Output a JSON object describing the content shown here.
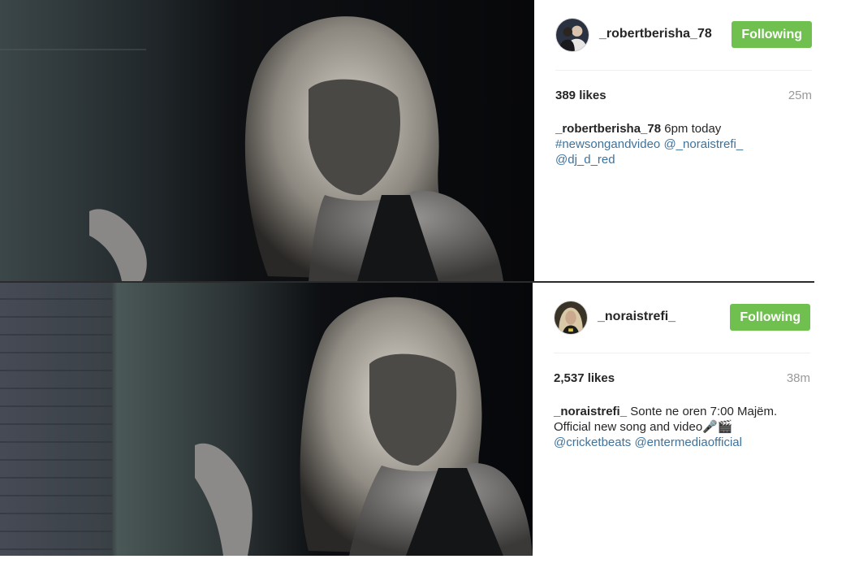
{
  "posts": [
    {
      "username": "_robertberisha_78",
      "follow_label": "Following",
      "likes": "389 likes",
      "time": "25m",
      "caption_user": "_robertberisha_78",
      "caption_text": "6pm today",
      "tags": [
        "#newsongandvideo",
        "@_noraistrefi_",
        "@dj_d_red"
      ]
    },
    {
      "username": "_noraistrefi_",
      "follow_label": "Following",
      "likes": "2,537 likes",
      "time": "38m",
      "caption_user": "_noraistrefi_",
      "caption_text": "Sonte ne oren 7:00 Majëm.",
      "caption_line2": "Official new song and video🎤🎬",
      "tags": [
        "@cricketbeats",
        "@entermediaofficial"
      ]
    }
  ],
  "colors": {
    "follow_button": "#70c050",
    "link": "#3f729b",
    "muted": "#999999"
  }
}
